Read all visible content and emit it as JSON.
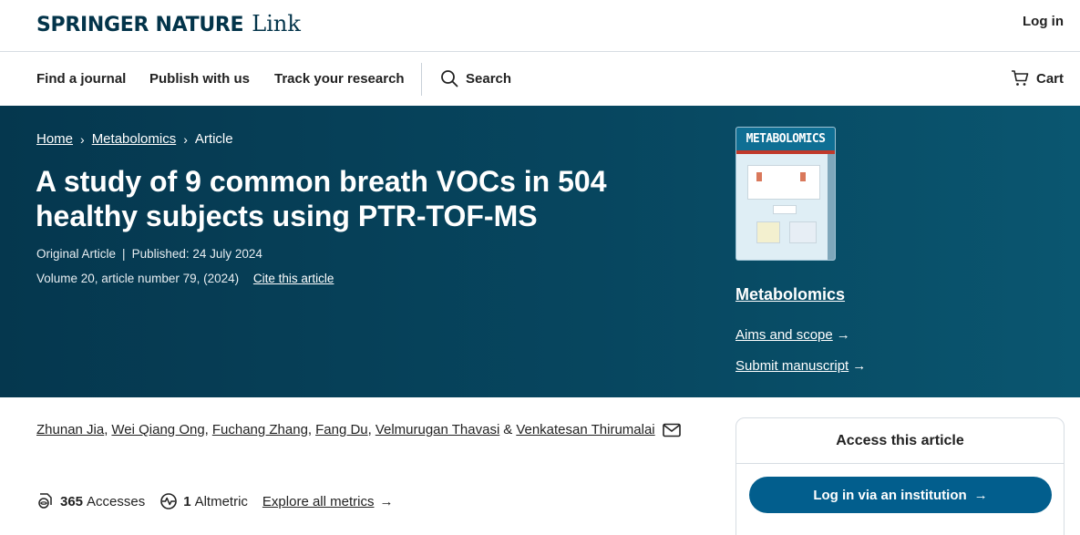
{
  "header": {
    "logo_brand": "SPRINGER NATURE",
    "logo_product": "Link",
    "login": "Log in"
  },
  "nav": {
    "items": [
      "Find a journal",
      "Publish with us",
      "Track your research"
    ],
    "search": "Search",
    "cart": "Cart"
  },
  "breadcrumb": {
    "home": "Home",
    "journal": "Metabolomics",
    "current": "Article"
  },
  "article": {
    "title_line1": "A study of 9 common breath VOCs in 504",
    "title_line2": "healthy subjects using PTR-TOF-MS",
    "type": "Original Article",
    "published": "Published: 24 July 2024",
    "volume": "Volume 20, article number 79, (2024)",
    "cite": "Cite this article"
  },
  "journal": {
    "cover_title": "METABOLOMICS",
    "name": "Metabolomics",
    "aims": "Aims and scope",
    "submit": "Submit manuscript"
  },
  "authors": [
    "Zhunan Jia",
    "Wei Qiang Ong",
    "Fuchang Zhang",
    "Fang Du",
    "Velmurugan Thavasi",
    "Venkatesan Thirumalai"
  ],
  "authors_sep": "&",
  "metrics": {
    "accesses_count": "365",
    "accesses_label": "Accesses",
    "altmetric_count": "1",
    "altmetric_label": "Altmetric",
    "explore": "Explore all metrics"
  },
  "access_box": {
    "title": "Access this article",
    "login_button": "Log in via an institution"
  },
  "colors": {
    "brand": "#03344a",
    "hero": "#05374e",
    "button": "#025e8d"
  }
}
